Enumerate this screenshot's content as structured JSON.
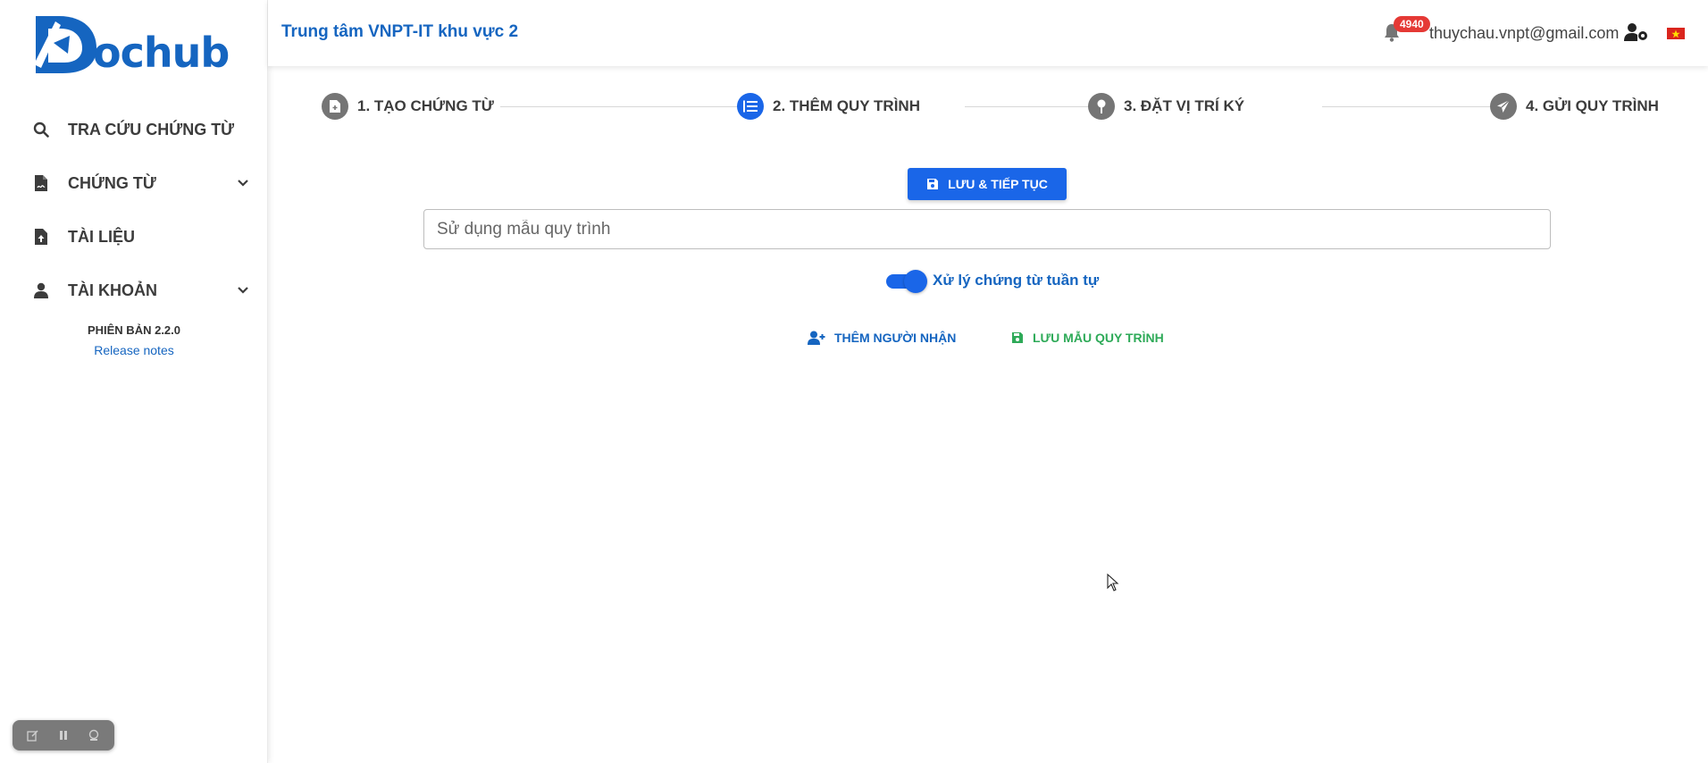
{
  "sidebar": {
    "logo_text": "ochub",
    "items": [
      {
        "label": "TRA CỨU CHỨNG TỪ",
        "icon": "search-icon",
        "has_chevron": false
      },
      {
        "label": "CHỨNG TỪ",
        "icon": "file-signature-icon",
        "has_chevron": true
      },
      {
        "label": "TÀI LIỆU",
        "icon": "file-upload-icon",
        "has_chevron": false
      },
      {
        "label": "TÀI KHOẢN",
        "icon": "user-icon",
        "has_chevron": true
      }
    ],
    "version": "PHIÊN BẢN 2.2.0",
    "release_notes": "Release notes"
  },
  "header": {
    "org_name": "Trung tâm VNPT-IT khu vực 2",
    "notification_count": "4940",
    "email": "thuychau.vnpt@gmail.com"
  },
  "stepper": {
    "steps": [
      {
        "label": "1. TẠO CHỨNG TỪ",
        "icon": "file-plus-icon",
        "active": false
      },
      {
        "label": "2. THÊM QUY TRÌNH",
        "icon": "list-ordered-icon",
        "active": true
      },
      {
        "label": "3. ĐẶT VỊ TRÍ KÝ",
        "icon": "map-pin-icon",
        "active": false
      },
      {
        "label": "4. GỬI QUY TRÌNH",
        "icon": "paper-plane-icon",
        "active": false
      }
    ]
  },
  "main": {
    "save_continue_label": "LƯU & TIẾP TỤC",
    "template_placeholder": "Sử dụng mẫu quy trình",
    "template_value": "",
    "sequential_label": "Xử lý chứng từ tuần tự",
    "sequential_on": true,
    "add_recipient_label": "THÊM NGƯỜI NHẬN",
    "save_template_label": "LƯU MẪU QUY TRÌNH"
  },
  "colors": {
    "primary": "#1a66e8",
    "brand_text": "#1565c0",
    "success": "#2eaa58",
    "badge": "#e53935",
    "inactive_step": "#757575"
  }
}
